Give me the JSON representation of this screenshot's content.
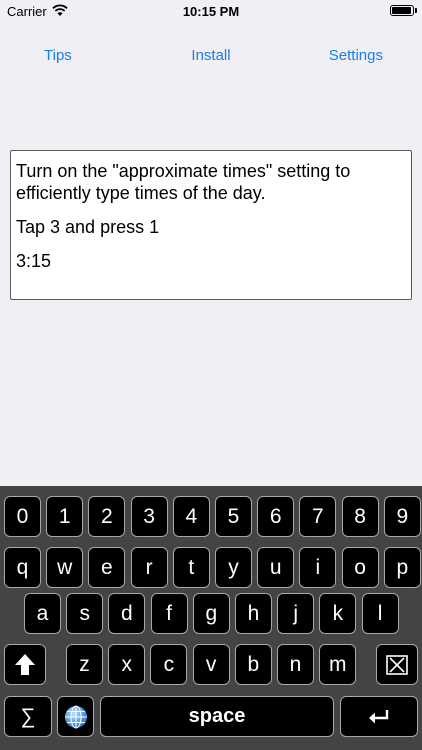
{
  "status_bar": {
    "carrier": "Carrier",
    "time": "10:15 PM",
    "battery_level": 0.95
  },
  "nav": {
    "tips": "Tips",
    "install": "Install",
    "settings": "Settings"
  },
  "text_box": {
    "line1": "Turn on the \"approximate times\" setting to",
    "line2": "efficiently type times of the day.",
    "line3": "Tap 3 and press 1",
    "line4": "3:15"
  },
  "keyboard": {
    "row_numbers": [
      "0",
      "1",
      "2",
      "3",
      "4",
      "5",
      "6",
      "7",
      "8",
      "9"
    ],
    "row_top": [
      "q",
      "w",
      "e",
      "r",
      "t",
      "y",
      "u",
      "i",
      "o",
      "p"
    ],
    "row_mid": [
      "a",
      "s",
      "d",
      "f",
      "g",
      "h",
      "j",
      "k",
      "l"
    ],
    "row_bottom": [
      "z",
      "x",
      "c",
      "v",
      "b",
      "n",
      "m"
    ],
    "sigma": "∑",
    "space": "space",
    "icons": {
      "shift": "shift-arrow-icon",
      "delete": "delete-x-icon",
      "globe": "globe-icon",
      "return": "return-arrow-icon"
    }
  }
}
